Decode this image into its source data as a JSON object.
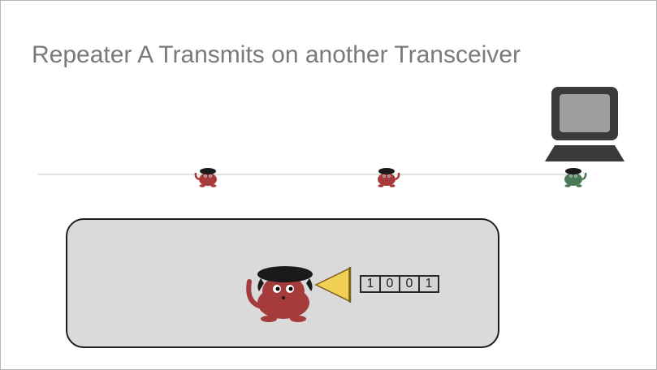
{
  "slide": {
    "title": "Repeater A Transmits on another Transceiver"
  },
  "colors": {
    "repeater": "#a63b3b",
    "end_station": "#4a7a55",
    "megaphone": "#f2cf55",
    "panel": "#dadada"
  },
  "bus": {
    "nodes": [
      {
        "label": "repeater",
        "icon": "creature-icon"
      },
      {
        "label": "repeater",
        "icon": "creature-icon"
      },
      {
        "label": "end-station",
        "icon": "creature-icon"
      }
    ],
    "computer_icon": "computer-icon"
  },
  "detail": {
    "megaphone_icon": "megaphone-icon",
    "bits": [
      "1",
      "0",
      "0",
      "1"
    ]
  }
}
